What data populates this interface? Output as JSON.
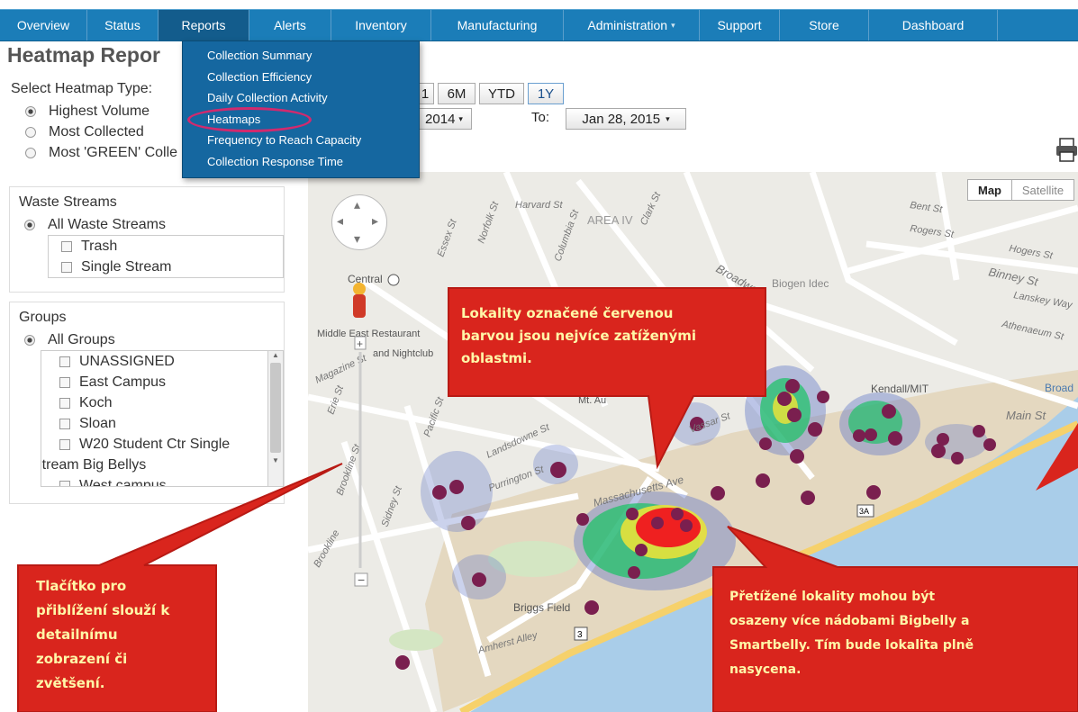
{
  "nav": {
    "items": [
      "Overview",
      "Status",
      "Reports",
      "Alerts",
      "Inventory",
      "Manufacturing",
      "Administration",
      "Support",
      "Store",
      "Dashboard"
    ],
    "active": "Reports",
    "administration_has_caret": true
  },
  "reports_menu": {
    "items": [
      "Collection Summary",
      "Collection Efficiency",
      "Daily Collection Activity",
      "Heatmaps",
      "Frequency to Reach Capacity",
      "Collection Response Time"
    ],
    "highlighted": "Heatmaps"
  },
  "page": {
    "title": "Heatmap Repor"
  },
  "heatmap_type": {
    "title": "Select Heatmap Type:",
    "options": [
      "Highest Volume",
      "Most Collected",
      "Most 'GREEN' Colle"
    ],
    "selected": "Highest Volume"
  },
  "waste_streams": {
    "title": "Waste Streams",
    "all_label": "All Waste Streams",
    "items": [
      "Trash",
      "Single Stream"
    ]
  },
  "groups": {
    "title": "Groups",
    "all_label": "All Groups",
    "items": [
      "UNASSIGNED",
      "East Campus",
      "Koch",
      "Sloan",
      "W20 Student Ctr Single",
      "Stream Big Bellys",
      "West campus"
    ]
  },
  "date_range": {
    "ranges": [
      "1",
      "6M",
      "YTD",
      "1Y"
    ],
    "from_value": "2014",
    "to_label": "To:",
    "to_value": "Jan 28, 2015"
  },
  "map": {
    "type_buttons": [
      "Map",
      "Satellite"
    ],
    "selected_type": "Map",
    "labels": [
      "Harvard St",
      "AREA IV",
      "Essex St",
      "Norfolk St",
      "Columbia St",
      "Clark St",
      "Broadway",
      "Binney St",
      "Hogers St",
      "Bent St",
      "Rogers St",
      "Lanskey Way",
      "Athenaeum St",
      "Biogen Idec",
      "Main St",
      "Massachusetts Ave",
      "Vassar St",
      "Landsdowne St",
      "Pacific St",
      "Purrington St",
      "Sidney St",
      "Brookline St",
      "Erie St",
      "Magazine St",
      "Brookline",
      "Central",
      "Middle East Restaurant",
      "and Nightclub",
      "Briggs Field",
      "Amherst Alley",
      "Kendall/MIT",
      "Mt. Au",
      "Broad",
      "3",
      "3A"
    ],
    "colors": {
      "water": "#a9cde9",
      "land": "#ecebe6",
      "road": "#ffffff",
      "highway": "#f6d16b",
      "campus": "#e4d8c0"
    }
  },
  "callouts": {
    "top": "Lokality označené červenou barvou jsou nejvíce zatíženými oblastmi.",
    "top_lines": [
      "Lokality označené červenou",
      "barvou jsou nejvíce zatíženými",
      "oblastmi."
    ],
    "left_lines": [
      "Tlačítko pro",
      "přiblížení slouží k",
      "detailnímu",
      "zobrazení či",
      "zvětšení."
    ],
    "right_lines": [
      "Přetížené lokality mohou být",
      "osazeny více nádobami Bigbelly a",
      "Smartbelly. Tím bude lokalita plně",
      "nasycena."
    ],
    "color": "#d9251d",
    "text_color": "#fff7a8"
  },
  "icons": [
    "print-icon",
    "pan-control-icon",
    "zoom-in-icon",
    "zoom-out-icon",
    "pegman-icon",
    "train-icon"
  ]
}
